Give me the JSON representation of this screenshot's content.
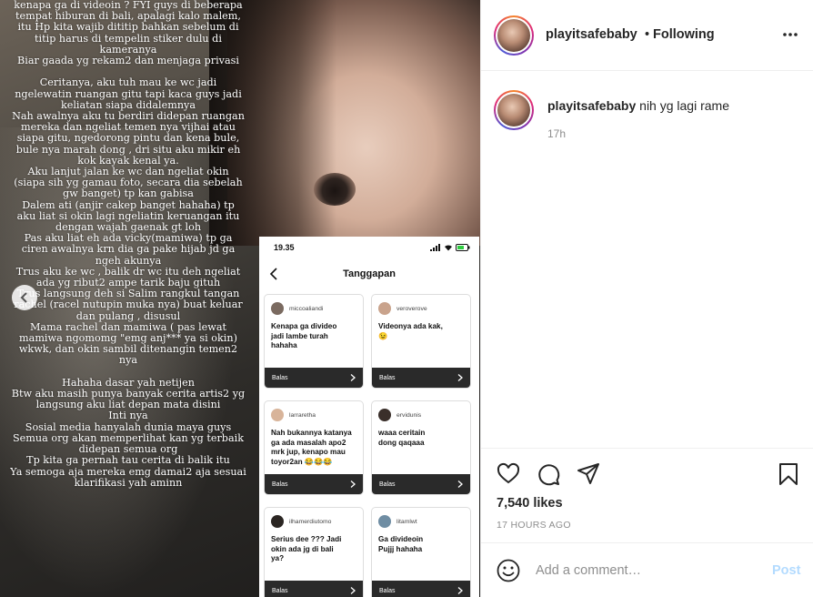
{
  "media": {
    "story_lines": [
      "kenapa ga di videoin ? FYI guys di beberapa",
      "tempat hiburan di bali, apalagi kalo malem,",
      "itu Hp kita wajib dititip bahkan sebelum di",
      "titip harus di tempelin stiker dulu di",
      "kameranya",
      "Biar gaada yg rekam2 dan menjaga privasi",
      "",
      "Ceritanya, aku tuh mau ke wc jadi",
      "ngelewatin ruangan gitu tapi kaca guys jadi",
      "keliatan siapa didalemnya",
      "Nah awalnya aku tu berdiri didepan ruangan",
      "mereka dan ngeliat temen nya vijhai atau",
      "siapa gitu, ngedorong pintu dan kena bule,",
      "bule nya marah dong , dri situ aku mikir eh",
      "kok kayak kenal ya.",
      "Aku lanjut jalan ke wc dan ngeliat okin",
      "(siapa sih yg gamau foto, secara dia sebelah",
      "gw banget) tp kan gabisa",
      "Dalem ati (anjir cakep banget hahaha) tp",
      "aku liat si okin lagi ngeliatin keruangan itu",
      "dengan wajah gaenak gt loh",
      "Pas aku liat eh ada vicky(mamiwa) tp ga",
      "ciren awalnya krn dia ga pake hijab jd ga",
      "ngeh akunya",
      "Trus aku ke wc , balik dr wc itu deh ngeliat",
      "ada yg ribut2 ampe tarik baju gituh",
      "Trus langsung deh si Salim rangkul tangan",
      "rachel (racel nutupin muka nya) buat keluar",
      "dan pulang , disusul",
      "Mama rachel dan mamiwa ( pas lewat",
      "mamiwa ngomomg \"emg anj*** ya si okin)",
      "wkwk, dan okin sambil ditenangin temen2",
      "nya",
      "",
      "Hahaha dasar yah netijen",
      "Btw aku masih punya banyak cerita artis2 yg",
      "langsung aku liat depan mata disini",
      "Inti nya",
      "Sosial media hanyalah dunia maya guys",
      "Semua org akan memperlihat kan yg terbaik",
      "didepan semua org",
      "Tp kita ga pernah tau cerita di balik itu",
      "Ya semoga aja mereka emg damai2 aja sesuai",
      "klarifikasi yah aminn"
    ],
    "phone": {
      "time": "19.35",
      "title": "Tanggapan",
      "reply_label": "Balas",
      "cards": [
        {
          "user": "miccoaliandi",
          "message": "Kenapa ga divideo\njadi lambe turah\nhahaha",
          "avatar_color": "#7a6a60"
        },
        {
          "user": "veroverove",
          "message": "Videonya ada kak,\n😉",
          "avatar_color": "#c9a38c"
        },
        {
          "user": "larraretha",
          "message": "Nah bukannya katanya\nga ada masalah apo2\nmrk jup, kenapo mau\ntoyor2an 😂😂😂",
          "avatar_color": "#d8b49a"
        },
        {
          "user": "ervidunis",
          "message": "waaa ceritain\ndong qaqaaa",
          "avatar_color": "#3a2f2a"
        },
        {
          "user": "ilhamerdiutomo",
          "message": "Serius dee ???  Jadi\nokin ada jg di bali\nya?",
          "avatar_color": "#2b2623"
        },
        {
          "user": "litamlwt",
          "message": "Ga divideoin\nPujjj hahaha",
          "avatar_color": "#6f8da3"
        }
      ]
    }
  },
  "header": {
    "username": "playitsafebaby",
    "separator": "•",
    "follow_status": "Following"
  },
  "caption": {
    "username": "playitsafebaby",
    "text": "nih yg lagi rame",
    "time": "17h"
  },
  "actions": {
    "likes": "7,540 likes",
    "posted_ago": "17 HOURS AGO"
  },
  "comment": {
    "placeholder": "Add a comment…",
    "post_label": "Post"
  },
  "colors": {
    "story_ring": [
      "#f58529",
      "#dd2a7b",
      "#8134af"
    ],
    "post_disabled": "#b3dbff",
    "muted_text": "#8e8e8e"
  }
}
